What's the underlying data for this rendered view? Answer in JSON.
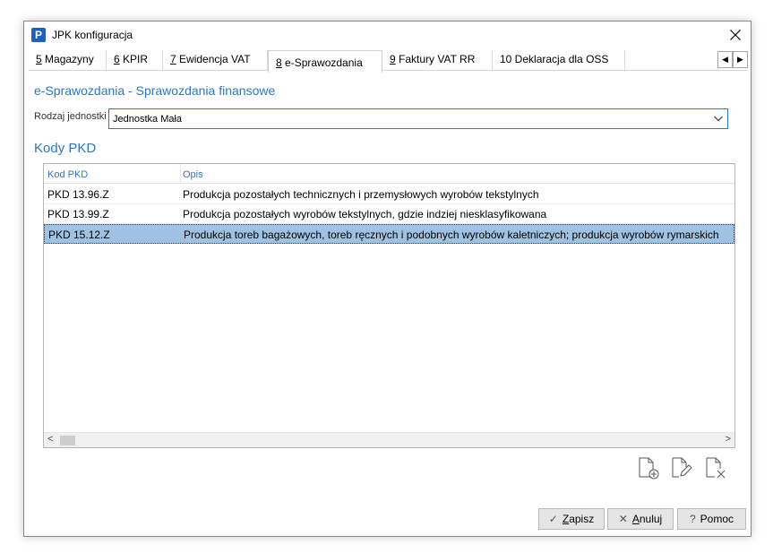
{
  "window": {
    "title": "JPK konfiguracja",
    "icon_letter": "P"
  },
  "tabs": [
    {
      "num": "5",
      "rest": " Magazyny"
    },
    {
      "num": "6",
      "rest": " KPIR"
    },
    {
      "num": "7",
      "rest": " Ewidencja VAT"
    },
    {
      "num": "8",
      "rest": " e-Sprawozdania"
    },
    {
      "num": "9",
      "rest": " Faktury VAT RR"
    },
    {
      "num": "10 D",
      "rest": "eklaracja dla OSS"
    }
  ],
  "active_tab": "8 e-Sprawozdania",
  "section": {
    "title": "e-Sprawozdania - Sprawozdania finansowe"
  },
  "rodzaj": {
    "label": "Rodzaj jednostki",
    "value": "Jednostka Mała"
  },
  "kody": {
    "title": "Kody PKD",
    "columns": [
      "Kod PKD",
      "Opis"
    ],
    "rows": [
      {
        "code": "PKD 13.96.Z",
        "desc": "Produkcja pozostałych technicznych i przemysłowych wyrobów tekstylnych"
      },
      {
        "code": "PKD 13.99.Z",
        "desc": "Produkcja pozostałych wyrobów tekstylnych, gdzie indziej niesklasyfikowana"
      },
      {
        "code": "PKD 15.12.Z",
        "desc": "Produkcja toreb bagażowych, toreb ręcznych i podobnych wyrobów kaletniczych; produkcja wyrobów rymarskich"
      }
    ],
    "selected_row": 2
  },
  "icons": [
    "add-document-icon",
    "edit-document-icon",
    "delete-document-icon"
  ],
  "buttons": {
    "save": {
      "u": "Z",
      "rest": "apisz"
    },
    "cancel": {
      "u": "A",
      "rest": "nuluj"
    },
    "help": {
      "label": "Pomoc"
    }
  },
  "colors": {
    "accent": "#2b78c5",
    "selection": "#9fc2e3",
    "button_bg": "#e5e5e5"
  }
}
